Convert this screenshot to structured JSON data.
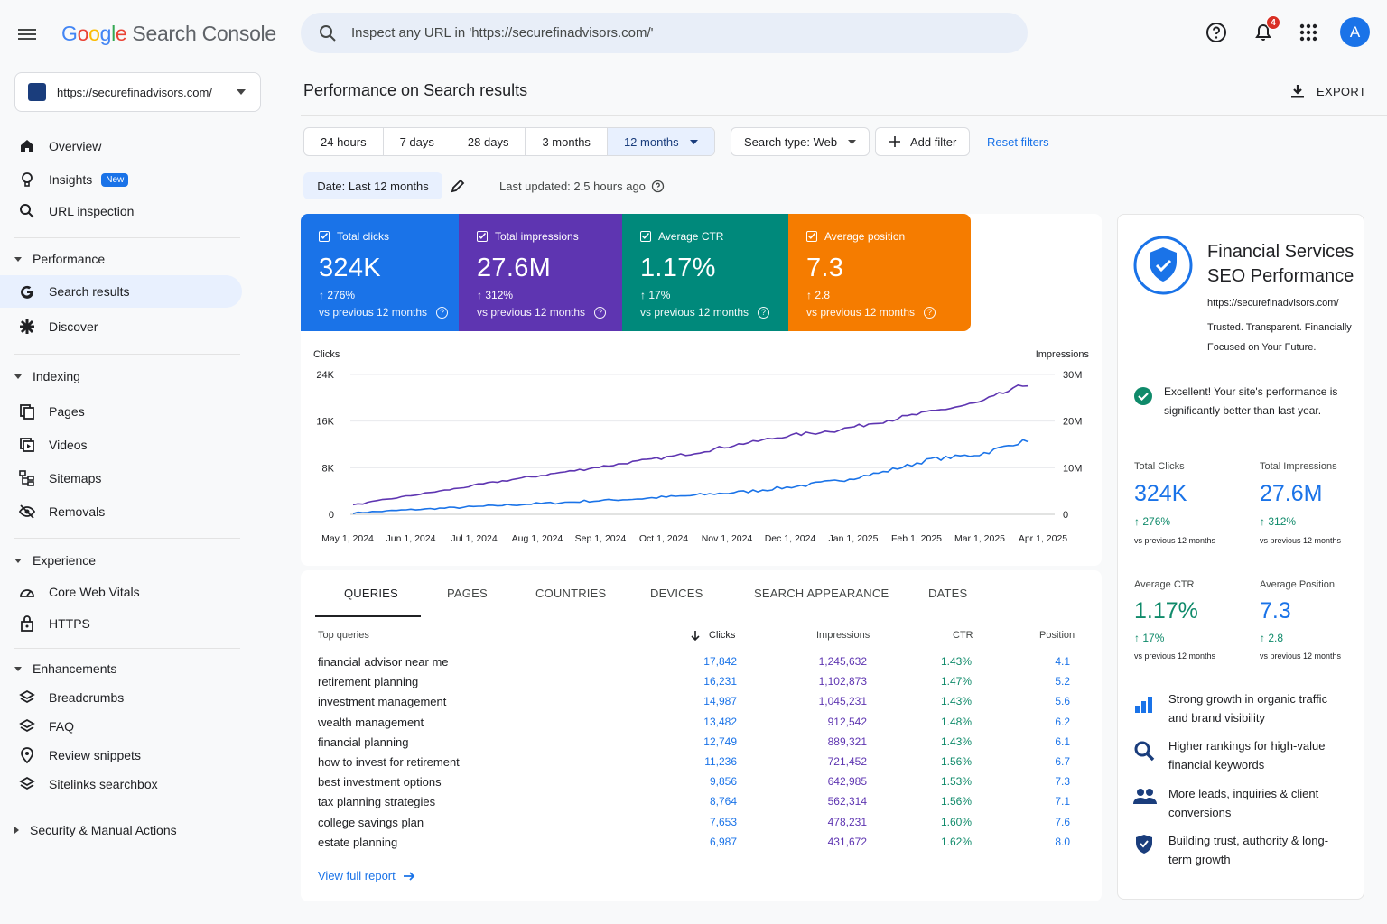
{
  "app": {
    "logo_google": "Google",
    "logo_product": "Search Console"
  },
  "search": {
    "placeholder": "Inspect any URL in 'https://securefinadvisors.com/'"
  },
  "header": {
    "notification_count": "4",
    "avatar_letter": "A"
  },
  "property": {
    "url": "https://securefinadvisors.com/"
  },
  "sidebar": {
    "overview": "Overview",
    "insights": "Insights",
    "insights_badge": "New",
    "url_inspection": "URL inspection",
    "performance": "Performance",
    "search_results": "Search results",
    "discover": "Discover",
    "indexing": "Indexing",
    "pages": "Pages",
    "videos": "Videos",
    "sitemaps": "Sitemaps",
    "removals": "Removals",
    "experience": "Experience",
    "core_web_vitals": "Core Web Vitals",
    "https": "HTTPS",
    "enhancements": "Enhancements",
    "breadcrumbs": "Breadcrumbs",
    "faq": "FAQ",
    "review_snippets": "Review snippets",
    "sitelinks_searchbox": "Sitelinks searchbox",
    "security": "Security & Manual Actions"
  },
  "page": {
    "title": "Performance on Search results",
    "export": "EXPORT"
  },
  "filters": {
    "ranges": [
      "24 hours",
      "7 days",
      "28 days",
      "3 months",
      "12 months"
    ],
    "selected_range": "12 months",
    "search_type": "Search type: Web",
    "add_filter": "Add filter",
    "reset": "Reset filters",
    "date_chip": "Date: Last 12 months",
    "last_updated": "Last updated: 2.5 hours ago"
  },
  "metrics": [
    {
      "label": "Total clicks",
      "value": "324K",
      "change": "276%",
      "vs": "vs previous 12 months",
      "color": "#1a73e8"
    },
    {
      "label": "Total impressions",
      "value": "27.6M",
      "change": "312%",
      "vs": "vs previous 12 months",
      "color": "#5e35b1"
    },
    {
      "label": "Average CTR",
      "value": "1.17%",
      "change": "17%",
      "vs": "vs previous 12 months",
      "color": "#00897b"
    },
    {
      "label": "Average position",
      "value": "7.3",
      "change": "2.8",
      "vs": "vs previous 12 months",
      "color": "#f57c00"
    }
  ],
  "chart_data": {
    "type": "line",
    "ylabel_left": "Clicks",
    "ylabel_right": "Impressions",
    "y_left_ticks": [
      "24K",
      "16K",
      "8K",
      "0"
    ],
    "y_right_ticks": [
      "30M",
      "20M",
      "10M",
      "0"
    ],
    "ylim_left": [
      0,
      24000
    ],
    "ylim_right": [
      0,
      30000000
    ],
    "x_ticks": [
      "May 1, 2024",
      "Jun 1, 2024",
      "Jul 1, 2024",
      "Aug 1, 2024",
      "Sep 1, 2024",
      "Oct 1, 2024",
      "Nov 1, 2024",
      "Dec 1, 2024",
      "Jan 1, 2025",
      "Feb 1, 2025",
      "Mar 1, 2025",
      "Apr 1, 2025"
    ],
    "series": [
      {
        "name": "Clicks",
        "axis": "left",
        "color": "#1a73e8",
        "values": [
          250,
          700,
          1100,
          1500,
          1900,
          2300,
          2700,
          3200,
          3800,
          4600,
          5700,
          7200,
          9500,
          10300,
          12800
        ]
      },
      {
        "name": "Impressions",
        "axis": "right",
        "color": "#5e35b1",
        "values": [
          2000000,
          3700000,
          5300000,
          7000000,
          8500000,
          10000000,
          11500000,
          13000000,
          15000000,
          16800000,
          18000000,
          20000000,
          22000000,
          24000000,
          28000000
        ]
      }
    ],
    "grid": true
  },
  "tabs": [
    "QUERIES",
    "PAGES",
    "COUNTRIES",
    "DEVICES",
    "SEARCH APPEARANCE",
    "DATES"
  ],
  "table": {
    "headers": {
      "query": "Top queries",
      "clicks": "Clicks",
      "impressions": "Impressions",
      "ctr": "CTR",
      "position": "Position"
    },
    "rows": [
      {
        "query": "financial advisor near me",
        "clicks": "17,842",
        "impressions": "1,245,632",
        "ctr": "1.43%",
        "position": "4.1"
      },
      {
        "query": "retirement planning",
        "clicks": "16,231",
        "impressions": "1,102,873",
        "ctr": "1.47%",
        "position": "5.2"
      },
      {
        "query": "investment management",
        "clicks": "14,987",
        "impressions": "1,045,231",
        "ctr": "1.43%",
        "position": "5.6"
      },
      {
        "query": "wealth management",
        "clicks": "13,482",
        "impressions": "912,542",
        "ctr": "1.48%",
        "position": "6.2"
      },
      {
        "query": "financial planning",
        "clicks": "12,749",
        "impressions": "889,321",
        "ctr": "1.43%",
        "position": "6.1"
      },
      {
        "query": "how to invest for retirement",
        "clicks": "11,236",
        "impressions": "721,452",
        "ctr": "1.56%",
        "position": "6.7"
      },
      {
        "query": "best investment options",
        "clicks": "9,856",
        "impressions": "642,985",
        "ctr": "1.53%",
        "position": "7.3"
      },
      {
        "query": "tax planning strategies",
        "clicks": "8,764",
        "impressions": "562,314",
        "ctr": "1.56%",
        "position": "7.1"
      },
      {
        "query": "college savings plan",
        "clicks": "7,653",
        "impressions": "478,231",
        "ctr": "1.60%",
        "position": "7.6"
      },
      {
        "query": "estate planning",
        "clicks": "6,987",
        "impressions": "431,672",
        "ctr": "1.62%",
        "position": "8.0"
      }
    ],
    "view_full": "View full report"
  },
  "summary": {
    "title": "Financial Services SEO Performance",
    "url": "https://securefinadvisors.com/",
    "tagline": "Trusted. Transparent. Financially Focused on Your Future.",
    "status": "Excellent! Your site's performance is significantly better than last year.",
    "stats": [
      {
        "label": "Total Clicks",
        "value": "324K",
        "change": "276%",
        "vs": "vs previous 12 months"
      },
      {
        "label": "Total Impressions",
        "value": "27.6M",
        "change": "312%",
        "vs": "vs previous 12 months"
      },
      {
        "label": "Average CTR",
        "value": "1.17%",
        "change": "17%",
        "vs": "vs previous 12 months"
      },
      {
        "label": "Average Position",
        "value": "7.3",
        "change": "2.8",
        "vs": "vs previous 12 months"
      }
    ],
    "points": [
      {
        "icon": "bar-chart-icon",
        "text": "Strong growth in organic traffic and brand visibility"
      },
      {
        "icon": "magnifier-icon",
        "text": "Higher rankings for high-value financial keywords"
      },
      {
        "icon": "people-icon",
        "text": "More leads, inquiries & client conversions"
      },
      {
        "icon": "shield-check-icon",
        "text": "Building trust, authority & long-term growth"
      }
    ]
  }
}
